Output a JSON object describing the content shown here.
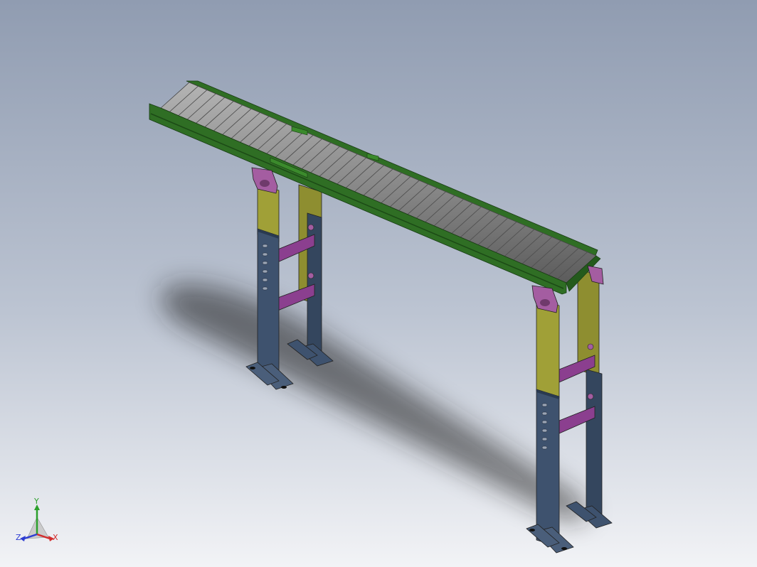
{
  "viewport": {
    "background_top": "#909cb1",
    "background_bottom": "#f2f3f6"
  },
  "model": {
    "part_colors": {
      "frame": "#2f6e24",
      "rollers": "#8f8f8f",
      "upper_leg": "#9a9a35",
      "lower_leg": "#3e526e",
      "brace": "#8b3f8f",
      "bracket": "#a45da1"
    }
  },
  "triad": {
    "x_label": "X",
    "y_label": "Y",
    "z_label": "Z",
    "x_color": "#d22c2c",
    "y_color": "#2ca02c",
    "z_color": "#2c3cd2"
  }
}
